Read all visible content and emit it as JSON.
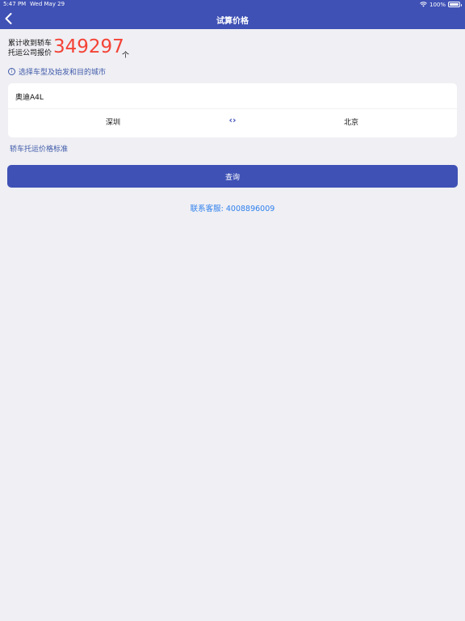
{
  "status_bar": {
    "time": "5:47 PM",
    "date": "Wed May 29",
    "battery": "100%"
  },
  "nav": {
    "title": "试算价格",
    "back_icon": "chevron-left-icon"
  },
  "counter": {
    "label": "累计收到轿车托运公司报价",
    "value": "349297",
    "unit": "个"
  },
  "hint": {
    "icon": "info-icon",
    "text": "选择车型及始发和目的城市"
  },
  "form": {
    "car_model": "奥迪A4L",
    "from_city": "深圳",
    "swap_icon": "swap-arrows-icon",
    "to_city": "北京"
  },
  "price_standard_link": "轿车托运价格标准",
  "query_button": "查询",
  "contact": "联系客服: 4008896009",
  "colors": {
    "primary": "#3f51b5",
    "accent_red": "#f44336",
    "link_blue": "#2f80ed",
    "background": "#efeff4"
  }
}
